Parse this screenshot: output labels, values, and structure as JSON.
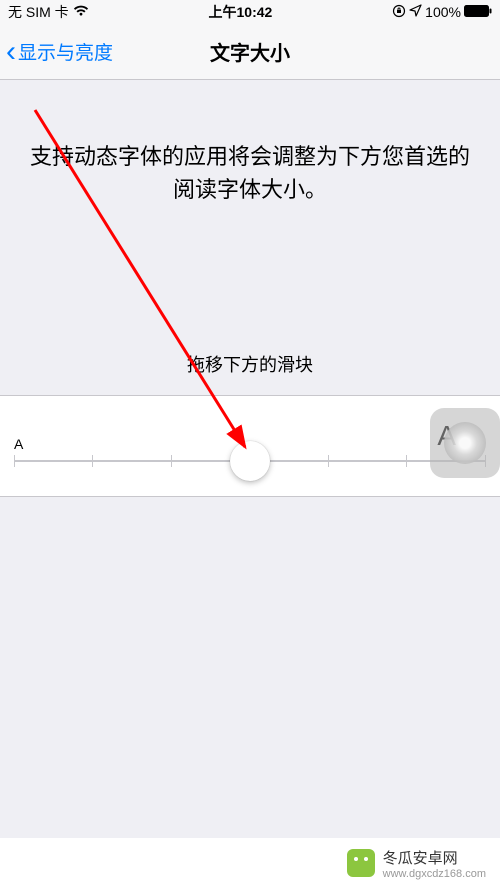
{
  "statusBar": {
    "carrier": "无 SIM 卡",
    "time": "上午10:42",
    "battery": "100%"
  },
  "nav": {
    "back": "显示与亮度",
    "title": "文字大小"
  },
  "main": {
    "description": "支持动态字体的应用将会调整为下方您首选的阅读字体大小。",
    "instruction": "拖移下方的滑块",
    "smallLabel": "A",
    "largeLabel": "A",
    "sliderPercent": 50
  },
  "watermark": {
    "title": "冬瓜安卓网",
    "url": "www.dgxcdz168.com"
  }
}
